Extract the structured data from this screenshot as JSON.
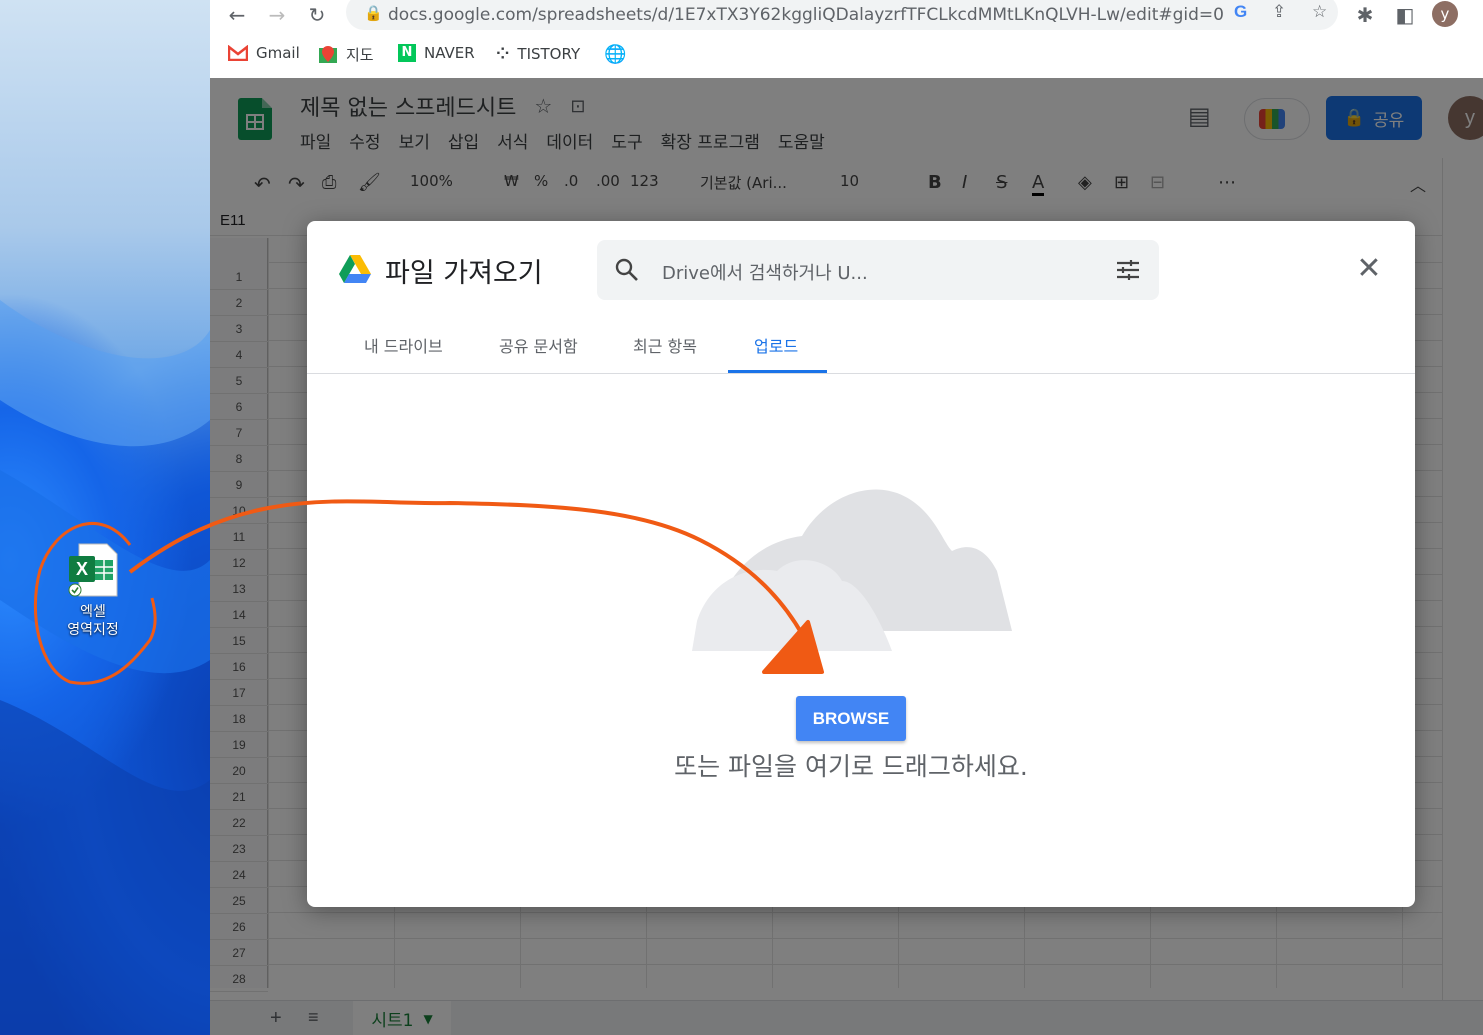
{
  "browser": {
    "url": "docs.google.com/spreadsheets/d/1E7xTX3Y62kggliQDalayzrfTFCLkcdMMtLKnQLVH-Lw/edit#gid=0",
    "profile_initial": "y",
    "bookmarks": [
      {
        "label": "Gmail",
        "icon": "gmail-icon"
      },
      {
        "label": "지도",
        "icon": "maps-icon"
      },
      {
        "label": "NAVER",
        "icon": "naver-icon"
      },
      {
        "label": "TISTORY",
        "icon": "tistory-icon"
      },
      {
        "label": "",
        "icon": "globe-icon"
      }
    ]
  },
  "desktop": {
    "icon_label_line1": "엑셀",
    "icon_label_line2": "영역지정"
  },
  "sheets": {
    "title": "제목 없는 스프레드시트",
    "menu": [
      "파일",
      "수정",
      "보기",
      "삽입",
      "서식",
      "데이터",
      "도구",
      "확장 프로그램",
      "도움말"
    ],
    "share_label": "공유",
    "avatar_initial": "y",
    "toolbar": {
      "zoom": "100%",
      "currency": "₩",
      "percent": "%",
      "dec_less": ".0",
      "dec_more": ".00",
      "format_more": "123",
      "font": "기본값 (Ari...",
      "font_size": "10"
    },
    "cell_ref": "E11",
    "rows": [
      "1",
      "2",
      "3",
      "4",
      "5",
      "6",
      "7",
      "8",
      "9",
      "10",
      "11",
      "12",
      "13",
      "14",
      "15",
      "16",
      "17",
      "18",
      "19",
      "20",
      "21",
      "22",
      "23",
      "24",
      "25",
      "26",
      "27",
      "28"
    ],
    "sheet_tab": "시트1"
  },
  "dialog": {
    "title": "파일 가져오기",
    "search_placeholder": "Drive에서 검색하거나 U...",
    "tabs": [
      "내 드라이브",
      "공유 문서함",
      "최근 항목",
      "업로드"
    ],
    "active_tab": "업로드",
    "browse_label": "BROWSE",
    "drop_text": "또는 파일을 여기로 드래그하세요."
  },
  "colors": {
    "accent": "#1a73e8",
    "browse": "#4285f4",
    "share": "#1a73e8",
    "annotation": "#f05a14"
  }
}
